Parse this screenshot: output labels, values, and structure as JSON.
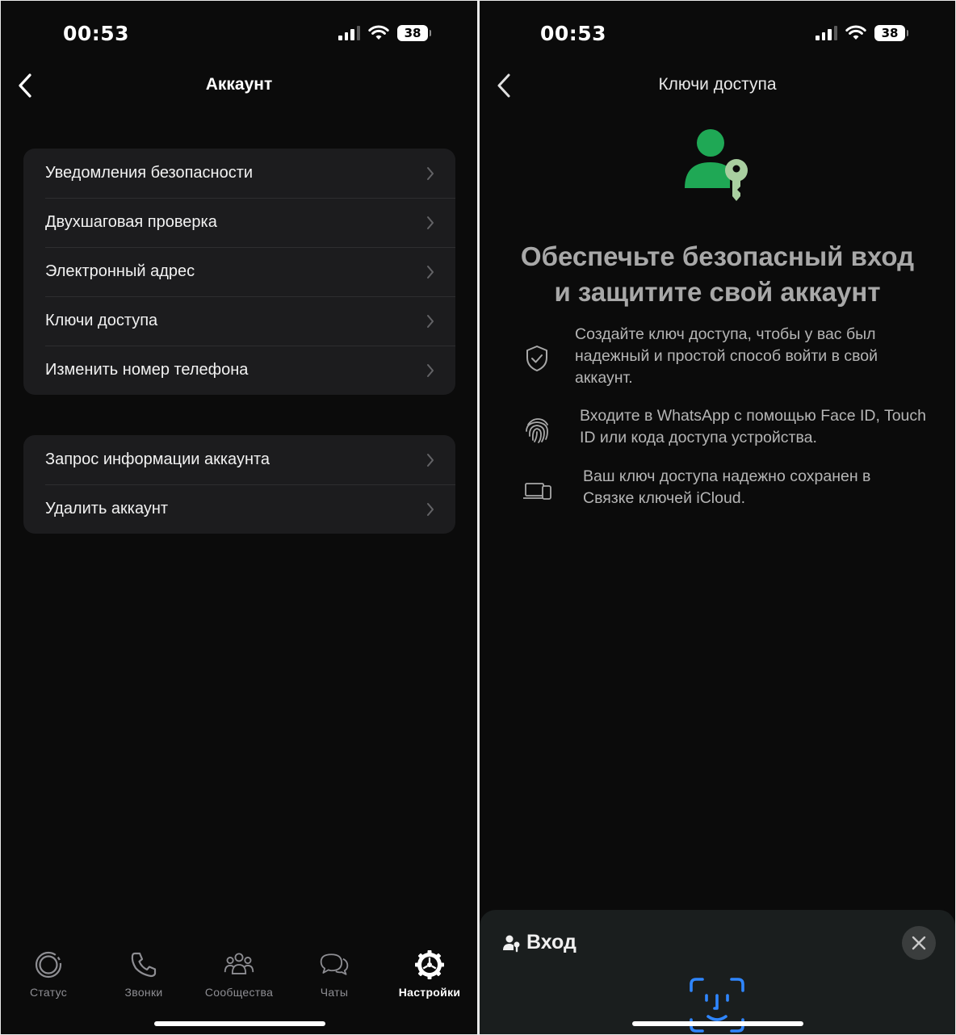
{
  "left_screen": {
    "status": {
      "time": "00:53",
      "battery": "38"
    },
    "nav": {
      "title": "Аккаунт",
      "back_icon": "chevron-left-icon"
    },
    "group1": [
      {
        "label": "Уведомления безопасности"
      },
      {
        "label": "Двухшаговая проверка"
      },
      {
        "label": "Электронный адрес"
      },
      {
        "label": "Ключи доступа"
      },
      {
        "label": "Изменить номер телефона"
      }
    ],
    "group2": [
      {
        "label": "Запрос информации аккаунта"
      },
      {
        "label": "Удалить аккаунт"
      }
    ],
    "tabs": [
      {
        "label": "Статус",
        "icon": "status-icon",
        "active": false
      },
      {
        "label": "Звонки",
        "icon": "phone-icon",
        "active": false
      },
      {
        "label": "Сообщества",
        "icon": "communities-icon",
        "active": false
      },
      {
        "label": "Чаты",
        "icon": "chats-icon",
        "active": false
      },
      {
        "label": "Настройки",
        "icon": "settings-gear-icon",
        "active": true
      }
    ]
  },
  "right_screen": {
    "status": {
      "time": "00:53",
      "battery": "38"
    },
    "nav": {
      "title": "Ключи доступа",
      "back_icon": "chevron-left-icon"
    },
    "hero_icon": "passkey-user-icon",
    "headline_line1": "Обеспечьте безопасный вход",
    "headline_line2": "и защитите свой аккаунт",
    "features": [
      {
        "icon": "shield-check-icon",
        "text": "Создайте ключ доступа, чтобы у вас был надежный и простой способ войти в свой аккаунт."
      },
      {
        "icon": "fingerprint-icon",
        "text": "Входите в WhatsApp с помощью Face ID, Touch ID или кода доступа устройства."
      },
      {
        "icon": "devices-icon",
        "text": "Ваш ключ доступа надежно сохранен в Связке ключей iCloud."
      }
    ],
    "sheet": {
      "title": "Вход",
      "icon": "person-key-icon",
      "close_icon": "close-icon",
      "faceid_icon": "face-id-icon"
    }
  },
  "colors": {
    "background": "#0b0b0b",
    "cell": "#1c1c1e",
    "accent_green": "#1fa855",
    "key_green": "#a9cfa0",
    "faceid_blue": "#2f86ff"
  }
}
